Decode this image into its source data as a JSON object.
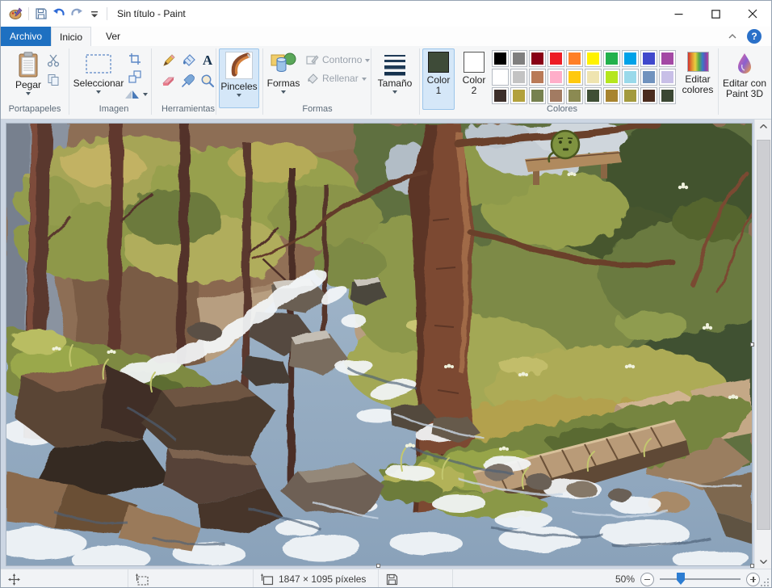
{
  "window": {
    "title": "Sin título - Paint"
  },
  "tabs": {
    "archivo": "Archivo",
    "inicio": "Inicio",
    "ver": "Ver"
  },
  "ribbon": {
    "clipboard": {
      "paste": "Pegar",
      "group": "Portapapeles"
    },
    "image": {
      "select": "Seleccionar",
      "group": "Imagen"
    },
    "tools": {
      "group": "Herramientas",
      "text_glyph": "A"
    },
    "brushes": {
      "label": "Pinceles"
    },
    "shapes": {
      "button": "Formas",
      "outline": "Contorno",
      "fill": "Rellenar",
      "group": "Formas"
    },
    "size": {
      "label": "Tamaño"
    },
    "colors": {
      "color1": "Color 1",
      "color2": "Color 2",
      "edit": "Editar colores",
      "group": "Colores",
      "color1_value": "#3e4b38",
      "color2_value": "#ffffff",
      "palette_rows": [
        [
          "#000000",
          "#7f7f7f",
          "#880015",
          "#ed1c24",
          "#ff7f27",
          "#fff200",
          "#22b14c",
          "#00a2e8",
          "#3f48cc",
          "#a349a4"
        ],
        [
          "#ffffff",
          "#c3c3c3",
          "#b97a57",
          "#ffaec9",
          "#ffc90e",
          "#efe4b0",
          "#b5e61d",
          "#99d9ea",
          "#7092be",
          "#c8bfe7"
        ],
        [
          "#3d2f2a",
          "#b2a13c",
          "#76814f",
          "#a27b62",
          "#8b8a52",
          "#3f4f35",
          "#a8842f",
          "#a39a3d",
          "#4b2c1f",
          "#3b4733"
        ]
      ]
    },
    "paint3d": {
      "label": "Editar con Paint 3D"
    }
  },
  "status_bar": {
    "image_size": "1847 × 1095 píxeles",
    "zoom_level": "50%"
  }
}
